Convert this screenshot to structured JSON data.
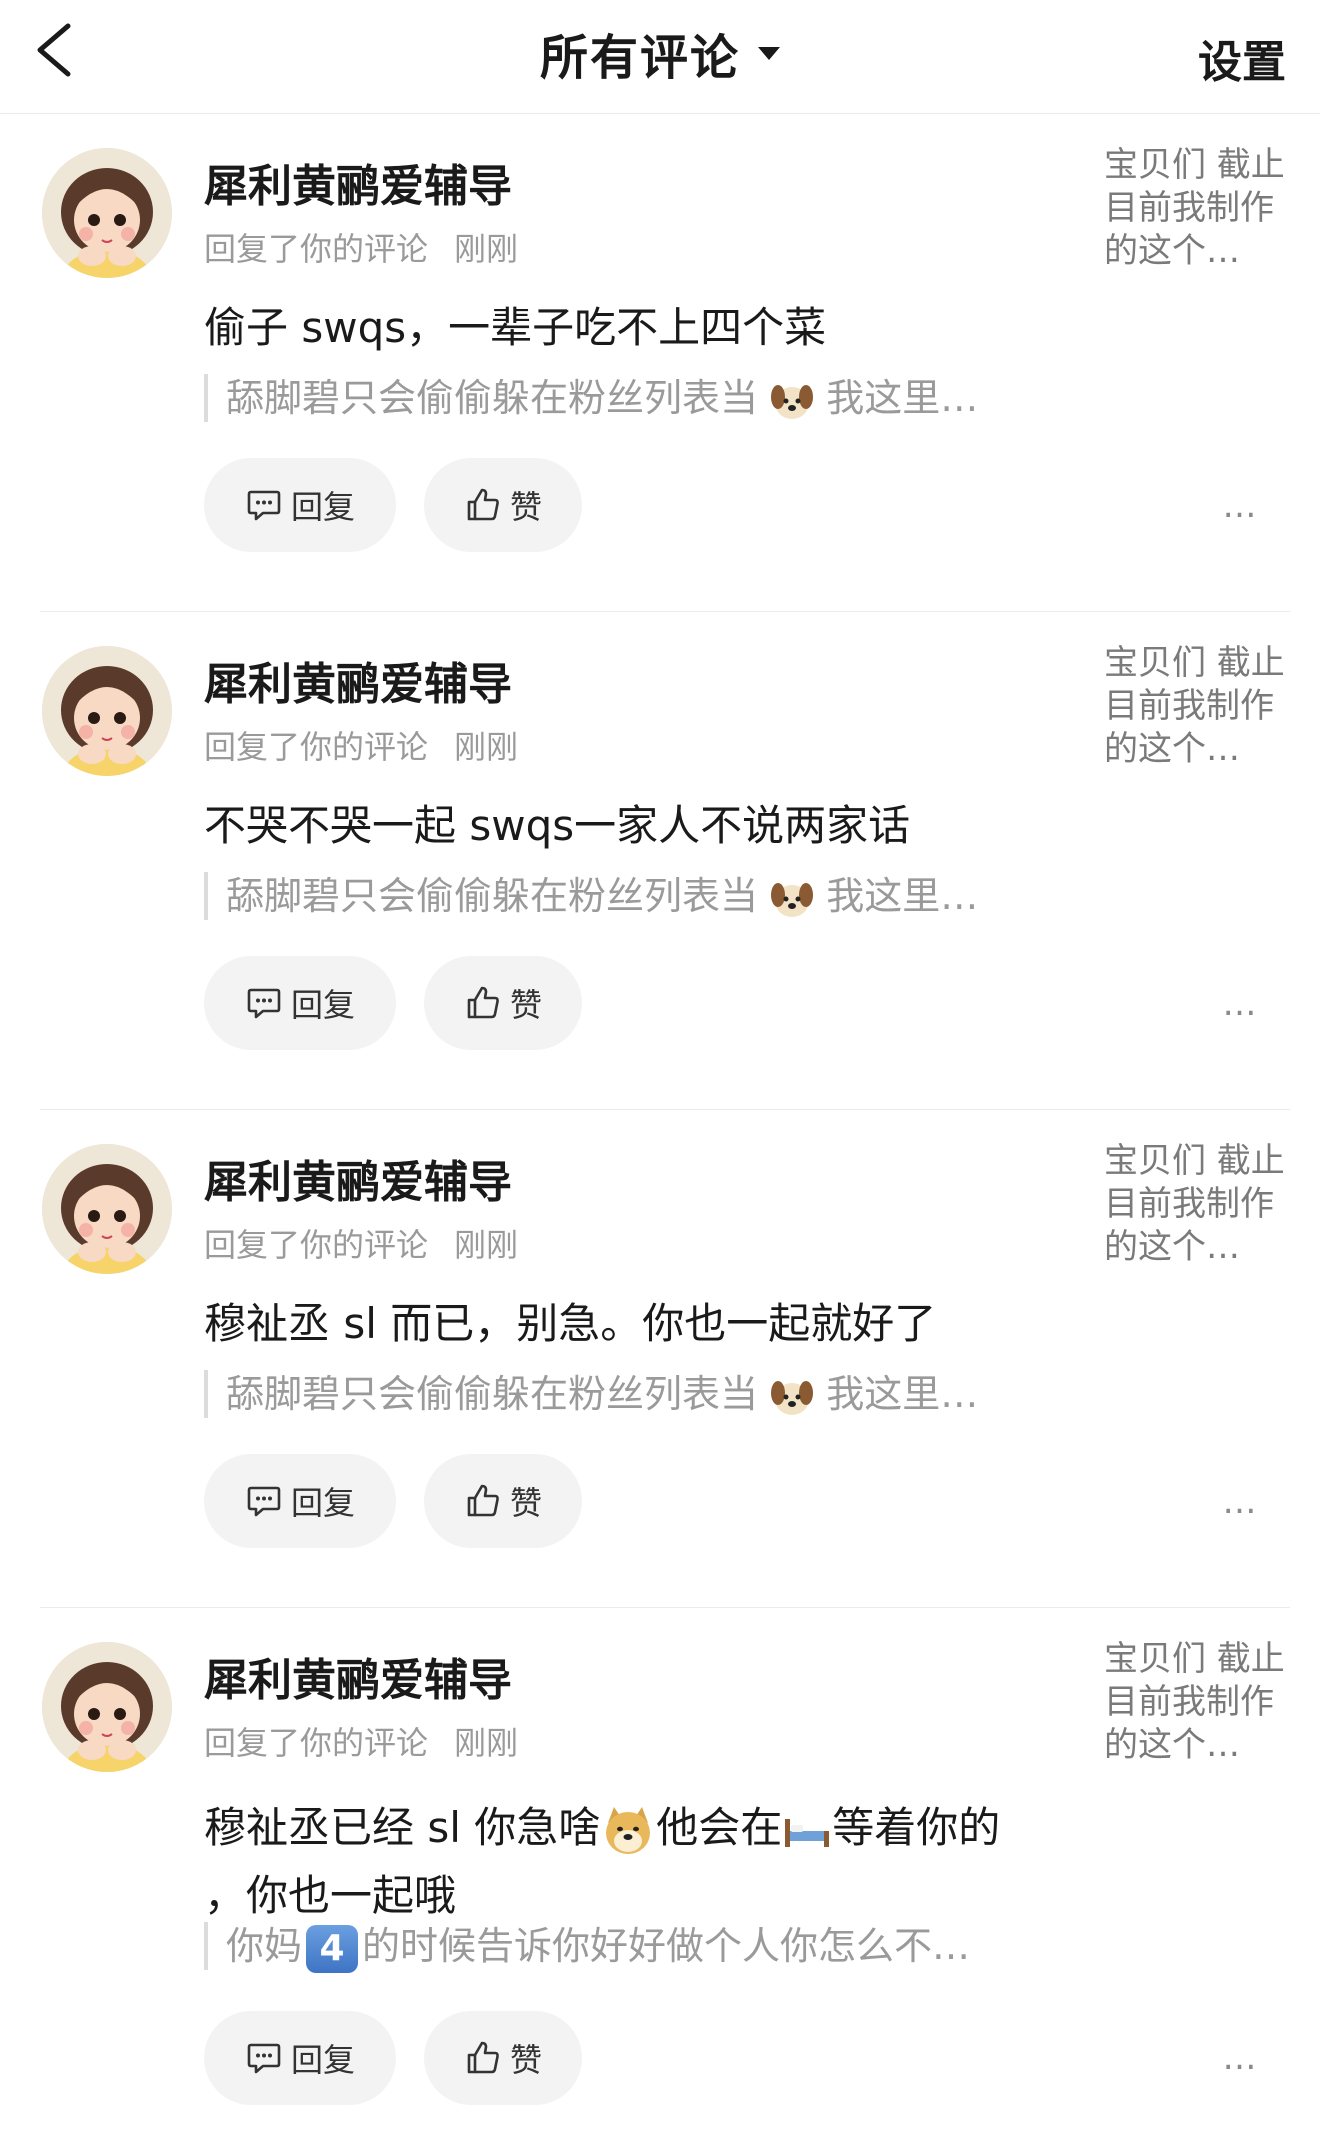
{
  "header": {
    "title": "所有评论",
    "settings_label": "设置"
  },
  "comments": [
    {
      "username": "犀利黄鹂爱辅导",
      "action": "回复了你的评论",
      "time": "刚刚",
      "body_parts": [
        "偷子 swqs，一辈子吃不上四个菜"
      ],
      "quote_parts": [
        "舔脚碧只会偷偷躲在粉丝列表当",
        "我这里…"
      ],
      "side_text": "宝贝们 截止目前我制作的这个…",
      "reply_label": "回复",
      "like_label": "赞",
      "more_label": "…"
    },
    {
      "username": "犀利黄鹂爱辅导",
      "action": "回复了你的评论",
      "time": "刚刚",
      "body_parts": [
        "不哭不哭一起 swqs一家人不说两家话"
      ],
      "quote_parts": [
        "舔脚碧只会偷偷躲在粉丝列表当",
        "我这里…"
      ],
      "side_text": "宝贝们 截止目前我制作的这个…",
      "reply_label": "回复",
      "like_label": "赞",
      "more_label": "…"
    },
    {
      "username": "犀利黄鹂爱辅导",
      "action": "回复了你的评论",
      "time": "刚刚",
      "body_parts": [
        "穆祉丞 sl 而已，别急。你也一起就好了"
      ],
      "quote_parts": [
        "舔脚碧只会偷偷躲在粉丝列表当",
        "我这里…"
      ],
      "side_text": "宝贝们 截止目前我制作的这个…",
      "reply_label": "回复",
      "like_label": "赞",
      "more_label": "…"
    },
    {
      "username": "犀利黄鹂爱辅导",
      "action": "回复了你的评论",
      "time": "刚刚",
      "body_parts": [
        "穆祉丞已经 sl 你急啥",
        "他会在",
        "等着你的",
        "，你也一起哦"
      ],
      "quote_parts": [
        "你妈",
        "4",
        "的时候告诉你好好做个人你怎么不…"
      ],
      "side_text": "宝贝们 截止目前我制作的这个…",
      "reply_label": "回复",
      "like_label": "赞",
      "more_label": "…"
    }
  ],
  "icons": {
    "back": "chevron-left-icon",
    "caret": "caret-down-icon",
    "reply": "comment-bubble-icon",
    "like": "thumbs-up-icon",
    "dog": "dog-face-emoji",
    "doge": "doge-emoji",
    "bed": "bed-emoji"
  }
}
